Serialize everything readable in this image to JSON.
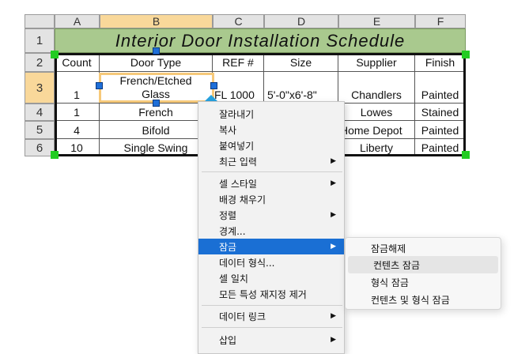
{
  "columns": [
    "A",
    "B",
    "C",
    "D",
    "E",
    "F"
  ],
  "rows": [
    "1",
    "2",
    "3",
    "4",
    "5",
    "6"
  ],
  "table": {
    "title": "Interior Door Installation Schedule",
    "headers": [
      "Count",
      "Door Type",
      "REF #",
      "Size",
      "Supplier",
      "Finish"
    ],
    "data": [
      [
        "1",
        "French/Etched Glass",
        "FL 1000",
        "5'-0\"x6'-8\"",
        "Chandlers",
        "Painted"
      ],
      [
        "1",
        "French",
        "",
        "",
        "Lowes",
        "Stained"
      ],
      [
        "4",
        "Bifold",
        "",
        "",
        "Home Depot",
        "Painted"
      ],
      [
        "10",
        "Single Swing",
        "",
        "",
        "Liberty",
        "Painted"
      ]
    ],
    "cell_b3_line1": "French/Etched",
    "cell_b3_line2": "Glass"
  },
  "context_menu": {
    "items": [
      {
        "label": "잘라내기",
        "arrow": ""
      },
      {
        "label": "복사",
        "arrow": ""
      },
      {
        "label": "붙여넣기",
        "arrow": ""
      },
      {
        "label": "최근 입력",
        "arrow": "▶"
      },
      {
        "label": "셀 스타일",
        "arrow": "▶"
      },
      {
        "label": "배경 채우기",
        "arrow": ""
      },
      {
        "label": "정렬",
        "arrow": "▶"
      },
      {
        "label": "경계...",
        "arrow": ""
      },
      {
        "label": "잠금",
        "arrow": "▶"
      },
      {
        "label": "데이터 형식...",
        "arrow": ""
      },
      {
        "label": "셀 일치",
        "arrow": ""
      },
      {
        "label": "모든 특성 재지정 제거",
        "arrow": ""
      },
      {
        "label": "데이터 링크",
        "arrow": "▶"
      },
      {
        "label": "삽입",
        "arrow": "▶"
      }
    ]
  },
  "submenu": {
    "items": [
      "잠금해제",
      "컨텐츠 잠금",
      "형식 잠금",
      "컨텐츠 및 형식 잠금"
    ]
  },
  "colors": {
    "title_bg": "#a9c98e",
    "active_header": "#f9d89a",
    "menu_highlight": "#1a6fd4",
    "grip_green": "#22cc22",
    "grip_blue": "#1f6fd8"
  }
}
